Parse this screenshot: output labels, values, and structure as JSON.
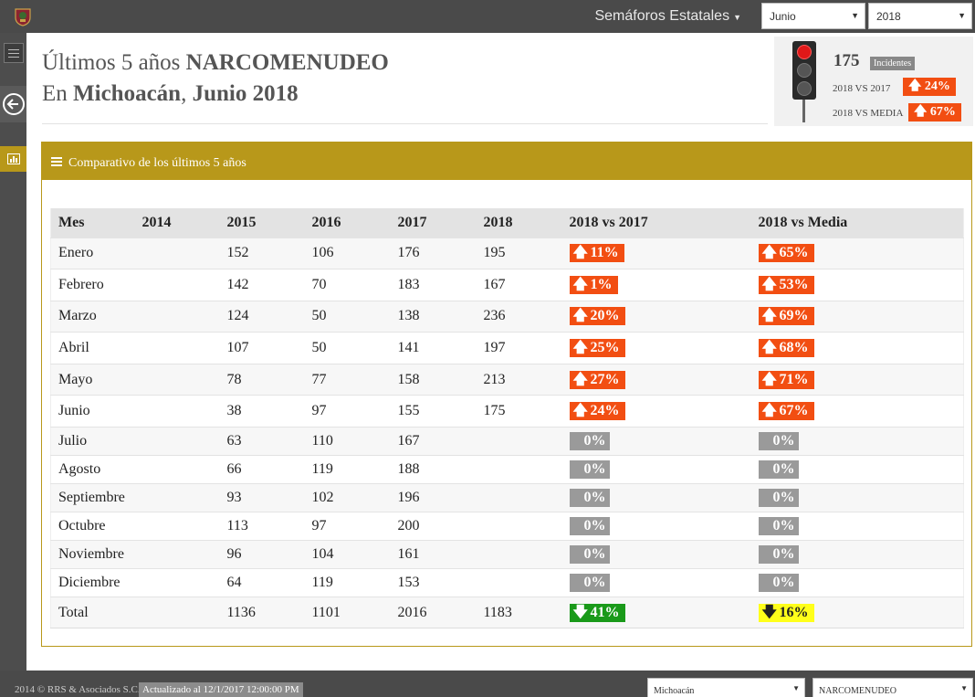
{
  "topbar": {
    "nav_title": "Semáforos Estatales",
    "month_select": "Junio",
    "year_select": "2018"
  },
  "header": {
    "line1_prefix": "Últimos 5 años",
    "line1_bold": "NARCOMENUDEO",
    "line2_prefix": "En",
    "line2_state": "Michoacán",
    "line2_sep": ",",
    "line2_date": "Junio 2018"
  },
  "summary": {
    "count": "175",
    "count_label": "Incidentes",
    "vs_prev_label": "2018 VS 2017",
    "vs_prev_value": "24%",
    "vs_mean_label": "2018 VS MEDIA",
    "vs_mean_value": "67%",
    "light_colors": {
      "active": "#e01818",
      "inactive": "#555555"
    }
  },
  "panel": {
    "title": "Comparativo de los últimos 5 años",
    "accent": "#b8981a"
  },
  "table": {
    "headers": [
      "Mes",
      "2014",
      "2015",
      "2016",
      "2017",
      "2018",
      "2018 vs 2017",
      "2018 vs Media"
    ],
    "rows": [
      {
        "mes": "Enero",
        "y2014": "",
        "y2015": "152",
        "y2016": "106",
        "y2017": "176",
        "y2018": "195",
        "vs2017": {
          "kind": "up",
          "text": "11%"
        },
        "vsmedia": {
          "kind": "up",
          "text": "65%"
        }
      },
      {
        "mes": "Febrero",
        "y2014": "",
        "y2015": "142",
        "y2016": "70",
        "y2017": "183",
        "y2018": "167",
        "vs2017": {
          "kind": "up",
          "text": "1%"
        },
        "vsmedia": {
          "kind": "up",
          "text": "53%"
        }
      },
      {
        "mes": "Marzo",
        "y2014": "",
        "y2015": "124",
        "y2016": "50",
        "y2017": "138",
        "y2018": "236",
        "vs2017": {
          "kind": "up",
          "text": "20%"
        },
        "vsmedia": {
          "kind": "up",
          "text": "69%"
        }
      },
      {
        "mes": "Abril",
        "y2014": "",
        "y2015": "107",
        "y2016": "50",
        "y2017": "141",
        "y2018": "197",
        "vs2017": {
          "kind": "up",
          "text": "25%"
        },
        "vsmedia": {
          "kind": "up",
          "text": "68%"
        }
      },
      {
        "mes": "Mayo",
        "y2014": "",
        "y2015": "78",
        "y2016": "77",
        "y2017": "158",
        "y2018": "213",
        "vs2017": {
          "kind": "up",
          "text": "27%"
        },
        "vsmedia": {
          "kind": "up",
          "text": "71%"
        }
      },
      {
        "mes": "Junio",
        "y2014": "",
        "y2015": "38",
        "y2016": "97",
        "y2017": "155",
        "y2018": "175",
        "vs2017": {
          "kind": "up",
          "text": "24%"
        },
        "vsmedia": {
          "kind": "up",
          "text": "67%"
        }
      },
      {
        "mes": "Julio",
        "y2014": "",
        "y2015": "63",
        "y2016": "110",
        "y2017": "167",
        "y2018": "",
        "vs2017": {
          "kind": "zero",
          "text": "0%"
        },
        "vsmedia": {
          "kind": "zero",
          "text": "0%"
        }
      },
      {
        "mes": "Agosto",
        "y2014": "",
        "y2015": "66",
        "y2016": "119",
        "y2017": "188",
        "y2018": "",
        "vs2017": {
          "kind": "zero",
          "text": "0%"
        },
        "vsmedia": {
          "kind": "zero",
          "text": "0%"
        }
      },
      {
        "mes": "Septiembre",
        "y2014": "",
        "y2015": "93",
        "y2016": "102",
        "y2017": "196",
        "y2018": "",
        "vs2017": {
          "kind": "zero",
          "text": "0%"
        },
        "vsmedia": {
          "kind": "zero",
          "text": "0%"
        }
      },
      {
        "mes": "Octubre",
        "y2014": "",
        "y2015": "113",
        "y2016": "97",
        "y2017": "200",
        "y2018": "",
        "vs2017": {
          "kind": "zero",
          "text": "0%"
        },
        "vsmedia": {
          "kind": "zero",
          "text": "0%"
        }
      },
      {
        "mes": "Noviembre",
        "y2014": "",
        "y2015": "96",
        "y2016": "104",
        "y2017": "161",
        "y2018": "",
        "vs2017": {
          "kind": "zero",
          "text": "0%"
        },
        "vsmedia": {
          "kind": "zero",
          "text": "0%"
        }
      },
      {
        "mes": "Diciembre",
        "y2014": "",
        "y2015": "64",
        "y2016": "119",
        "y2017": "153",
        "y2018": "",
        "vs2017": {
          "kind": "zero",
          "text": "0%"
        },
        "vsmedia": {
          "kind": "zero",
          "text": "0%"
        }
      }
    ],
    "total": {
      "mes": "Total",
      "y2014": "",
      "y2015": "1136",
      "y2016": "1101",
      "y2017": "2016",
      "y2018": "1183",
      "vs2017": {
        "kind": "down",
        "text": "41%"
      },
      "vsmedia": {
        "kind": "yellow",
        "text": "16%"
      }
    },
    "badge_colors": {
      "up": "#f24e12",
      "zero": "#9a9a9a",
      "down": "#1a9a1a",
      "yellow": "#ffff1a"
    }
  },
  "footer": {
    "copyright": "2014 © RRS & Asociados S.C.",
    "updated": "Actualizado al 12/1/2017 12:00:00 PM",
    "state_select": "Michoacán",
    "crime_select": "NARCOMENUDEO"
  }
}
